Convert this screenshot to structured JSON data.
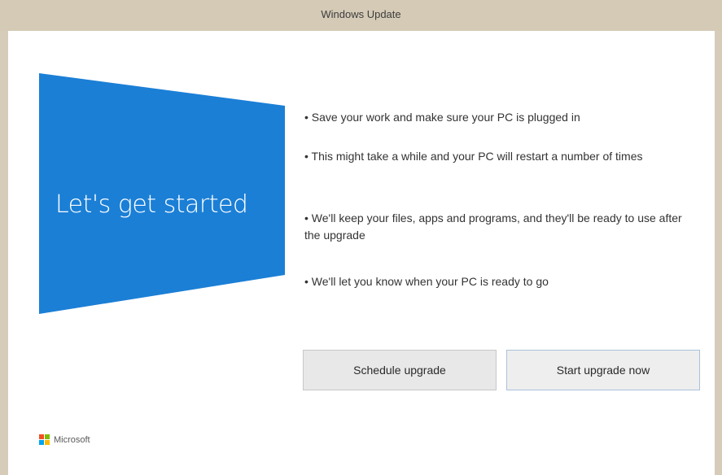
{
  "window": {
    "title": "Windows Update"
  },
  "tile": {
    "text": "Let's get started",
    "color": "#1b7fd6"
  },
  "bullets": [
    "• Save your work and make sure your PC is plugged in",
    "• This might take a while and your PC will restart a number of times",
    "• We'll keep your files, apps and programs, and they'll be ready to use after the upgrade",
    "• We'll let you know when your PC is ready to go"
  ],
  "buttons": {
    "schedule_label": "Schedule upgrade",
    "start_label": "Start upgrade now"
  },
  "brand": {
    "name": "Microsoft",
    "logo_icon": "microsoft-logo-icon"
  }
}
